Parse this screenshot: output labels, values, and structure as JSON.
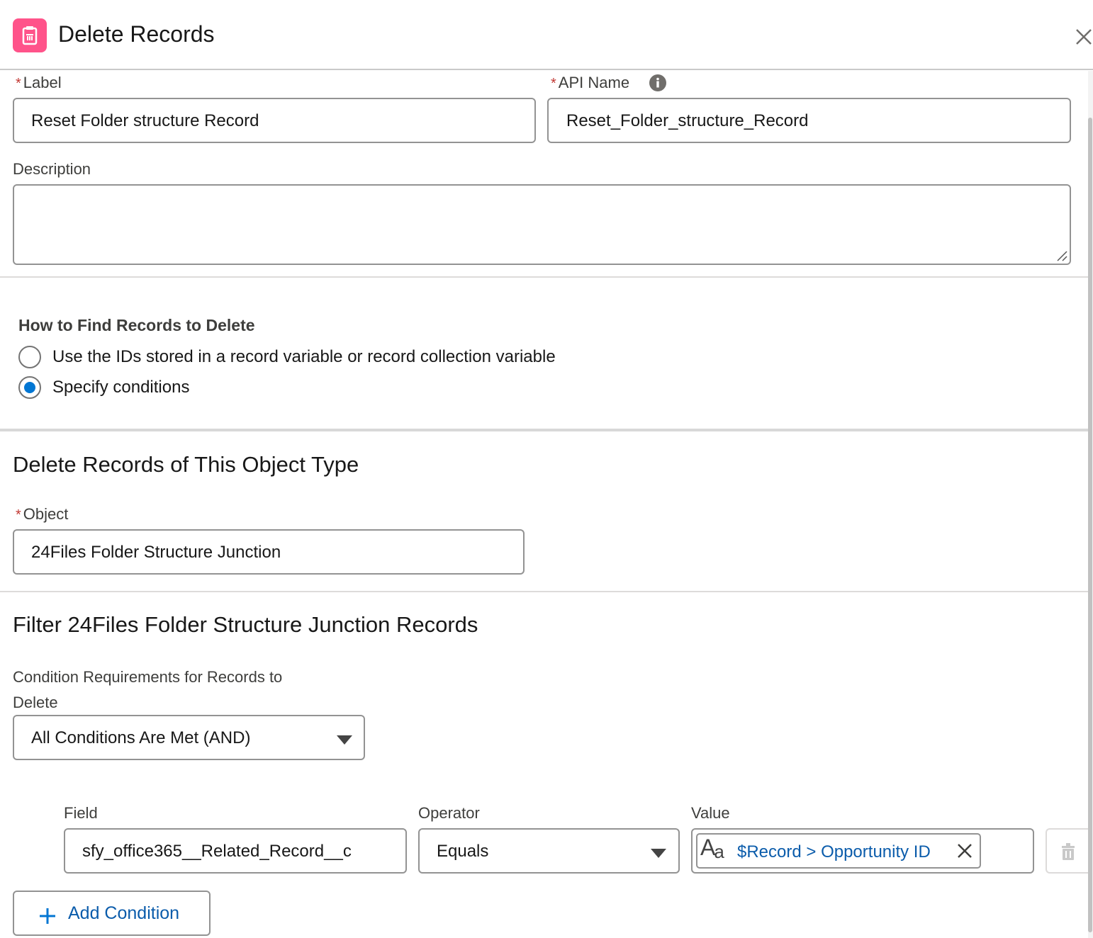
{
  "header": {
    "title": "Delete Records",
    "icon": "delete-records-icon",
    "icon_color": "#ff538a"
  },
  "form": {
    "label_field": {
      "label": "Label",
      "value": "Reset Folder structure Record"
    },
    "api_name_field": {
      "label": "API Name",
      "value": "Reset_Folder_structure_Record"
    },
    "description_field": {
      "label": "Description",
      "value": ""
    }
  },
  "find_records": {
    "heading": "How to Find Records to Delete",
    "options": [
      {
        "label": "Use the IDs stored in a record variable or record collection variable",
        "selected": false
      },
      {
        "label": "Specify conditions",
        "selected": true
      }
    ]
  },
  "object_section": {
    "heading": "Delete Records of This Object Type",
    "object_label": "Object",
    "object_value": "24Files Folder Structure Junction"
  },
  "filter_section": {
    "heading": "Filter 24Files Folder Structure Junction Records",
    "requirement_label_line1": "Condition Requirements for Records to",
    "requirement_label_line2": "Delete",
    "requirement_value": "All Conditions Are Met (AND)",
    "columns": {
      "field": "Field",
      "operator": "Operator",
      "value": "Value"
    },
    "conditions": [
      {
        "field": "sfy_office365__Related_Record__c",
        "operator": "Equals",
        "value_pill": "$Record > Opportunity ID"
      }
    ],
    "add_condition_label": "Add Condition"
  },
  "colors": {
    "accent": "#0176d3",
    "required": "#c23934",
    "border": "#939393"
  }
}
